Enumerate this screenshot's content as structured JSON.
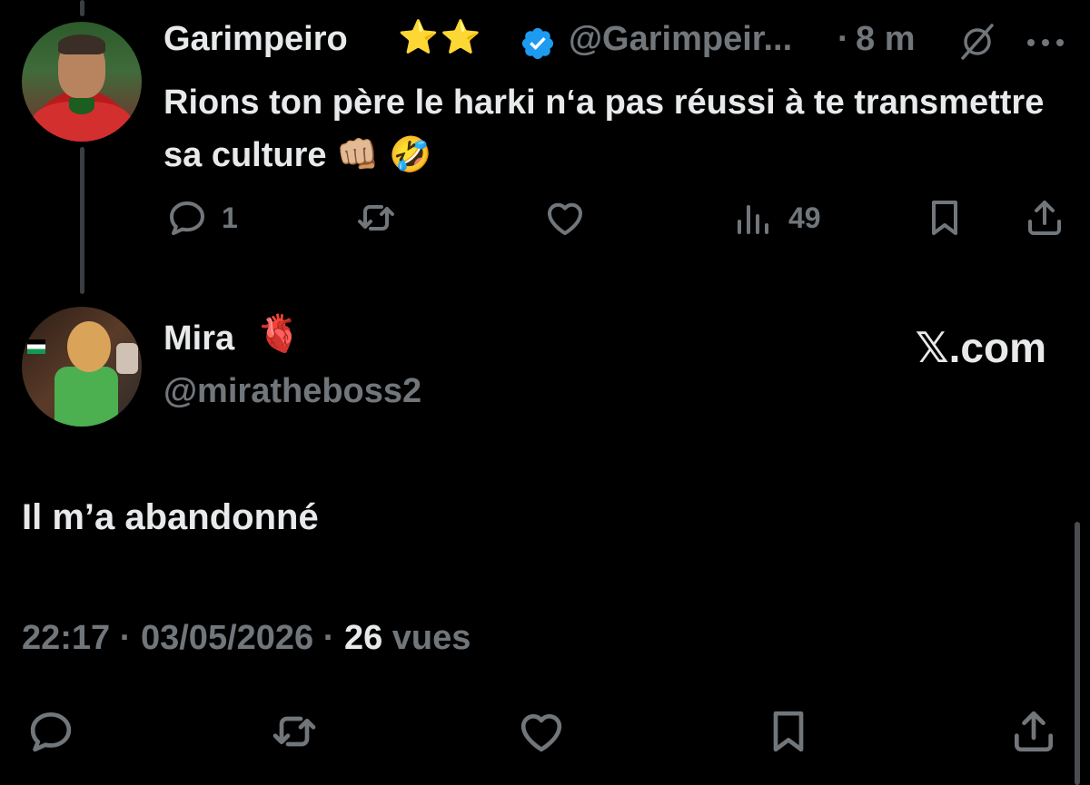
{
  "parent_tweet": {
    "display_name": "Garimpeiro",
    "name_badges": "⭐⭐",
    "handle": "@Garimpeir...",
    "separator": "·",
    "time_ago": "8 m",
    "text": "Rions ton père le harki n‘a pas réussi à te transmettre sa culture 👊🏼 🤣",
    "replies": "1",
    "views": "49",
    "icons": {
      "verified": "verified-badge-icon",
      "grok": "grok-icon",
      "more": "more-icon",
      "reply": "reply-icon",
      "retweet": "retweet-icon",
      "like": "like-icon",
      "views": "views-icon",
      "bookmark": "bookmark-icon",
      "share": "share-icon"
    }
  },
  "reply_tweet": {
    "display_name": "Mira",
    "name_emoji": "🫀",
    "handle": "@miratheboss2",
    "watermark": "𝕏.com",
    "text": "Il m’a abandonné",
    "time": "22:17",
    "date": "03/05/2026",
    "views_count": "26",
    "views_label": "vues",
    "separator": "·"
  },
  "colors": {
    "background": "#000000",
    "text": "#e7e9ea",
    "muted": "#71767b",
    "verified": "#1d9bf0",
    "thread_line": "#3a3d41"
  }
}
